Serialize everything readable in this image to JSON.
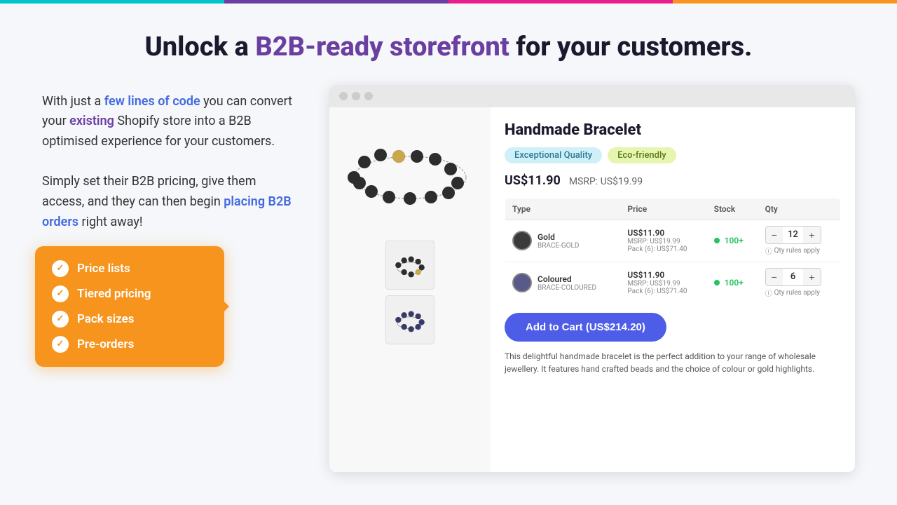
{
  "topBar": {
    "segments": [
      "cyan",
      "purple",
      "pink",
      "orange"
    ]
  },
  "header": {
    "title_prefix": "Unlock a ",
    "title_highlight": "B2B-ready storefront",
    "title_suffix": " for your customers."
  },
  "leftCol": {
    "para1_prefix": "With just a ",
    "para1_highlight1": "few lines of code",
    "para1_middle": " you can convert your ",
    "para1_highlight2": "existing",
    "para1_suffix": " Shopify store into a B2B optimised experience for your customers.",
    "para2_prefix": "Simply set their B2B pricing, give them access, and they can then begin ",
    "para2_highlight": "placing B2B orders",
    "para2_suffix": " right away!"
  },
  "featureBox": {
    "items": [
      "Price lists",
      "Tiered pricing",
      "Pack sizes",
      "Pre-orders"
    ]
  },
  "browser": {
    "product": {
      "title": "Handmade Bracelet",
      "badges": [
        "Exceptional Quality",
        "Eco-friendly"
      ],
      "price": "US$11.90",
      "msrp_label": "MSRP:",
      "msrp": "US$19.99",
      "table": {
        "headers": [
          "Type",
          "Price",
          "Stock",
          "Qty"
        ],
        "rows": [
          {
            "type_name": "Gold",
            "type_sku": "BRACE-GOLD",
            "price": "US$11.90",
            "msrp": "MSRP: US$19.99",
            "pack": "Pack (6): US$71.40",
            "stock": "100+",
            "qty": 12,
            "qty_rules": "Qty rules apply"
          },
          {
            "type_name": "Coloured",
            "type_sku": "BRACE-COLOURED",
            "price": "US$11.90",
            "msrp": "MSRP: US$19.99",
            "pack": "Pack (6): US$71.40",
            "stock": "100+",
            "qty": 6,
            "qty_rules": "Qty rules apply"
          }
        ]
      },
      "add_to_cart": "Add to Cart (US$214.20)",
      "description": "This delightful handmade bracelet is the perfect addition to your range of wholesale jewellery. It features hand crafted beads and the choice of colour or gold highlights."
    }
  }
}
